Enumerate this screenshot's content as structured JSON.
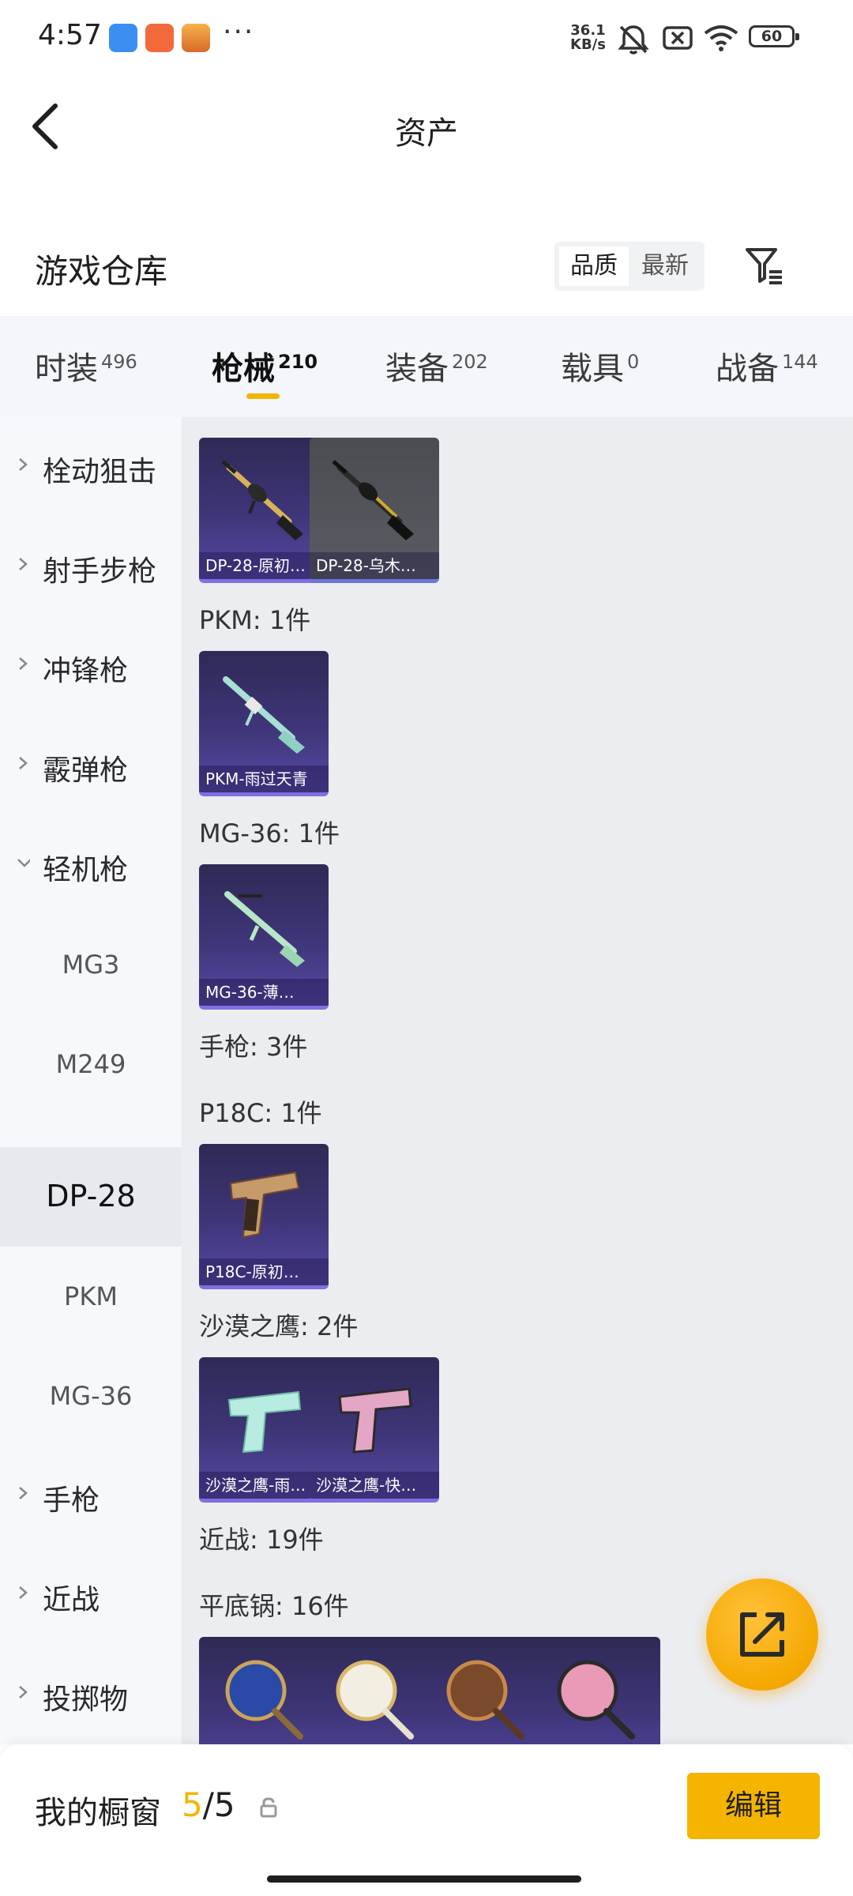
{
  "status_bar": {
    "time": "4:57",
    "more": "···",
    "speed_value": "36.1",
    "speed_unit": "KB/s",
    "battery": "60"
  },
  "header": {
    "title": "资产",
    "back_icon": "back-chevron-icon"
  },
  "section": {
    "title": "游戏仓库",
    "sort_options": [
      "品质",
      "最新"
    ],
    "sort_selected": "品质",
    "filter_icon": "filter-icon"
  },
  "tabs": [
    {
      "label": "时装",
      "count": "496"
    },
    {
      "label": "枪械",
      "count": "210",
      "active": true
    },
    {
      "label": "装备",
      "count": "202"
    },
    {
      "label": "载具",
      "count": "0"
    },
    {
      "label": "战备",
      "count": "144"
    }
  ],
  "sidebar": {
    "items": [
      {
        "label": "栓动狙击",
        "type": "category",
        "expanded": false
      },
      {
        "label": "射手步枪",
        "type": "category",
        "expanded": false
      },
      {
        "label": "冲锋枪",
        "type": "category",
        "expanded": false
      },
      {
        "label": "霰弹枪",
        "type": "category",
        "expanded": false
      },
      {
        "label": "轻机枪",
        "type": "category",
        "expanded": true
      },
      {
        "label": "MG3",
        "type": "sub"
      },
      {
        "label": "M249",
        "type": "sub"
      },
      {
        "label": "DP-28",
        "type": "sub",
        "selected": true
      },
      {
        "label": "PKM",
        "type": "sub"
      },
      {
        "label": "MG-36",
        "type": "sub"
      },
      {
        "label": "手枪",
        "type": "category",
        "expanded": false
      },
      {
        "label": "近战",
        "type": "category",
        "expanded": false
      },
      {
        "label": "投掷物",
        "type": "category",
        "expanded": false
      }
    ]
  },
  "content": {
    "dp28_items": [
      "DP-28-原初…",
      "DP-28-乌木…"
    ],
    "groups": [
      {
        "label": "PKM: 1件",
        "items": [
          "PKM-雨过天青"
        ]
      },
      {
        "label": "MG-36: 1件",
        "items": [
          "MG-36-薄…"
        ]
      },
      {
        "label": "手枪: 3件"
      },
      {
        "label": "P18C: 1件",
        "items": [
          "P18C-原初…"
        ]
      },
      {
        "label": "沙漠之鹰: 2件",
        "items": [
          "沙漠之鹰-雨…",
          "沙漠之鹰-快…"
        ]
      },
      {
        "label": "近战: 19件"
      },
      {
        "label": "平底锅: 16件"
      }
    ]
  },
  "fab": {
    "icon": "share-external-icon"
  },
  "bottom_bar": {
    "title": "我的橱窗",
    "count_current": "5",
    "count_sep": "/",
    "count_total": "5",
    "lock_icon": "lock-icon",
    "edit_label": "编辑"
  },
  "colors": {
    "accent": "#f5b400",
    "card_purple": "#3f3579",
    "card_gray": "#55575d",
    "sidebar_bg": "#f6f8fb",
    "content_bg": "#ebedf1"
  }
}
